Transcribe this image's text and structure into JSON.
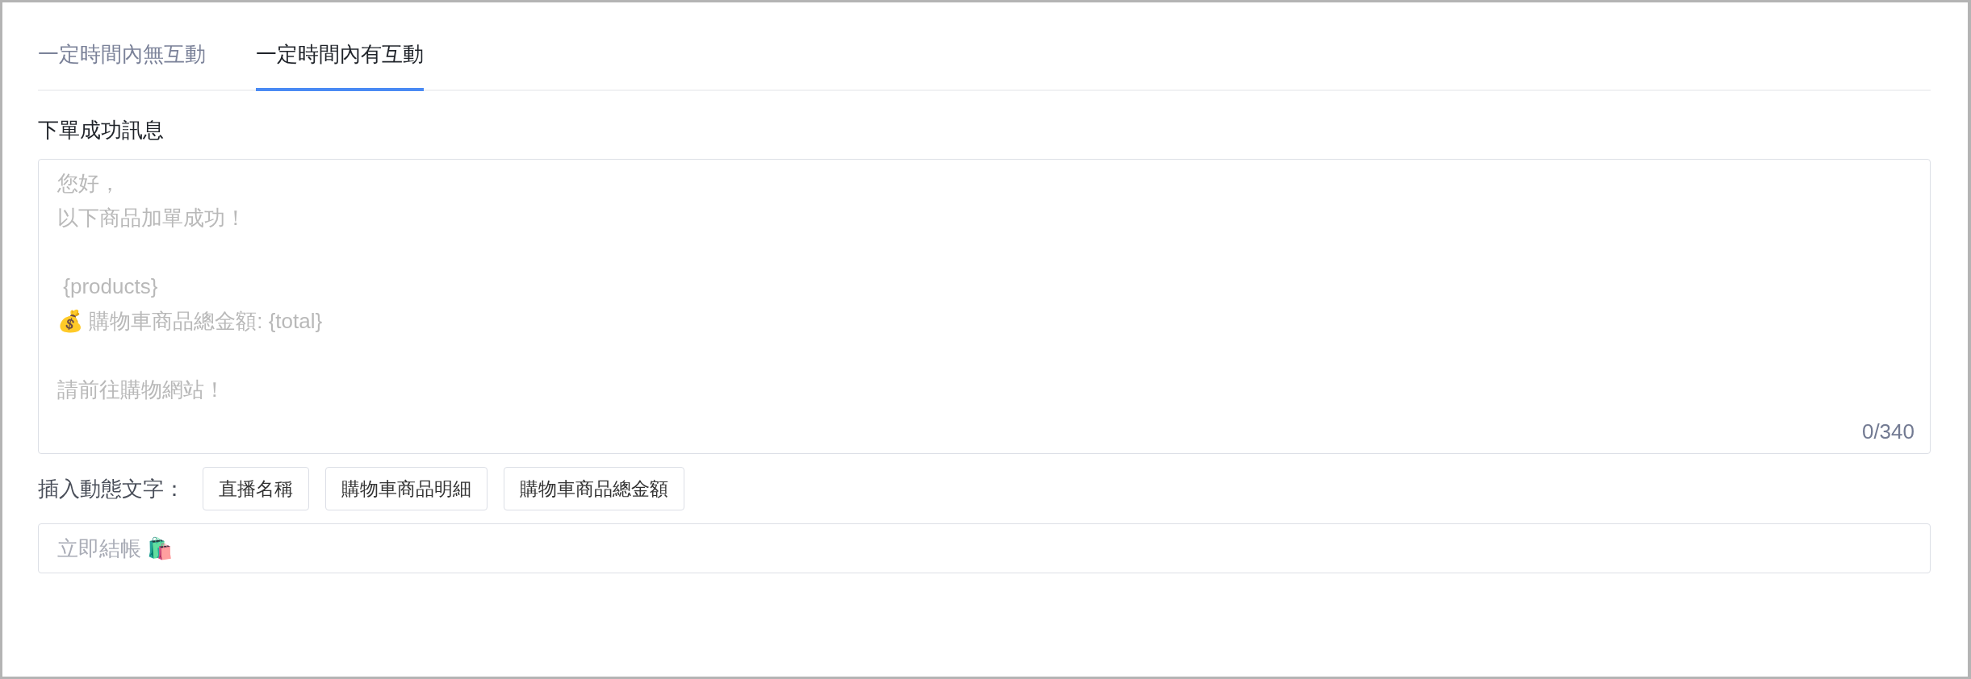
{
  "tabs": [
    {
      "label": "一定時間內無互動",
      "selected": false
    },
    {
      "label": "一定時間內有互動",
      "selected": true
    }
  ],
  "message": {
    "label": "下單成功訊息",
    "placeholder_paragraphs": [
      [
        "您好，",
        "以下商品加單成功！"
      ],
      [
        " {products}",
        "💰 購物車商品總金額: {total}"
      ],
      [
        "請前往購物網站！"
      ]
    ],
    "counter": "0/340"
  },
  "insert": {
    "label": "插入動態文字：",
    "buttons": [
      "直播名稱",
      "購物車商品明細",
      "購物車商品總金額"
    ]
  },
  "button_text": {
    "placeholder": "立即結帳 🛍️"
  }
}
